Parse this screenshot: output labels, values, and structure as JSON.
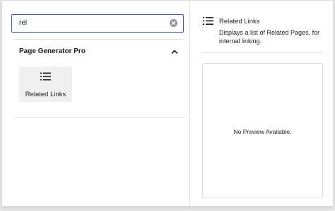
{
  "search": {
    "value": "rel"
  },
  "category": {
    "title": "Page Generator Pro",
    "icon": "chevron-up-icon"
  },
  "blocks": [
    {
      "label": "Related Links",
      "icon": "list-icon"
    }
  ],
  "preview": {
    "title": "Related Links",
    "description": "Displays a list of Related Pages, for internal linking.",
    "empty_message": "No Preview Available.",
    "icon": "list-icon"
  },
  "colors": {
    "accent": "#3858e9"
  }
}
